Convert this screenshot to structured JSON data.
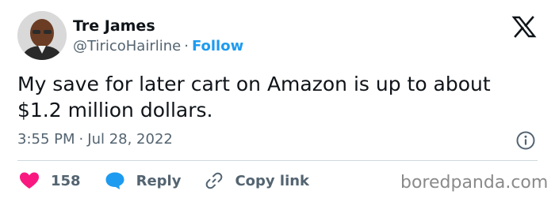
{
  "author": {
    "name": "Tre James",
    "handle": "@TiricoHairline",
    "separator": "·",
    "follow_label": "Follow"
  },
  "tweet": {
    "text_line1": "My save for later cart on Amazon is up to about",
    "text_line2": "$1.2 million dollars.",
    "time": "3:55 PM",
    "separator": "·",
    "date": "Jul 28, 2022"
  },
  "actions": {
    "like_count": "158",
    "reply_label": "Reply",
    "copy_link_label": "Copy link"
  },
  "watermark": "boredpanda.com",
  "colors": {
    "accent": "#1d9bf0",
    "like": "#f91880",
    "muted": "#536471"
  },
  "icons": {
    "brand": "x-logo-icon",
    "info": "info-icon",
    "like": "heart-icon",
    "reply": "speech-bubble-icon",
    "copy_link": "link-icon"
  }
}
